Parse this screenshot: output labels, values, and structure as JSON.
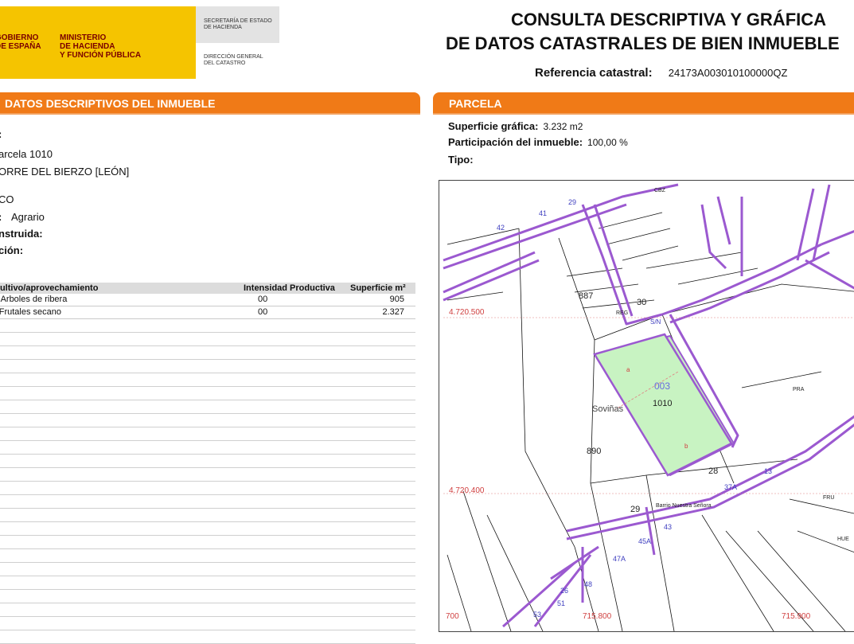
{
  "header": {
    "gov_line1": "GOBIERNO",
    "gov_line2": "DE ESPAÑA",
    "min_line1": "MINISTERIO",
    "min_line2": "DE HACIENDA",
    "min_line3": "Y FUNCIÓN PÚBLICA",
    "sec_line1": "SECRETARÍA DE ESTADO",
    "sec_line2": "DE HACIENDA",
    "dir_line1": "DIRECCIÓN GENERAL",
    "dir_line2": "DEL CATASTRO",
    "title_line1": "CONSULTA DESCRIPTIVA Y GRÁFICA",
    "title_line2": "DE DATOS CATASTRALES DE BIEN INMUEBLE",
    "ref_label": "Referencia catastral:",
    "ref_value": "24173A003010100000QZ"
  },
  "left": {
    "section_title": "DATOS DESCRIPTIVOS DEL INMUEBLE",
    "fields": {
      "f1": ":",
      "f2": "arcela 1010",
      "f3": "ORRE DEL BIERZO [LEÓN]",
      "f4": "CO",
      "f5_label": ":",
      "f5_value": "Agrario",
      "f6": "nstruida:",
      "f7": "ción:"
    },
    "table": {
      "headers": [
        "Cultivo/aprovechamiento",
        "Intensidad Productiva",
        "Superficie m²"
      ],
      "rows": [
        [
          "d Arboles de ribera",
          "00",
          "905"
        ],
        [
          "- Frutales secano",
          "00",
          "2.327"
        ]
      ]
    }
  },
  "right": {
    "section_title": "PARCELA",
    "sup_label": "Superficie gráfica:",
    "sup_value": "3.232 m2",
    "part_label": "Participación del inmueble:",
    "part_value": "100,00 %",
    "tipo_label": "Tipo:"
  },
  "map": {
    "coord_y1": "4.720.500",
    "coord_y2": "4.720.400",
    "coord_x1": "700",
    "coord_x2": "715.800",
    "coord_x3": "715.900",
    "polygon": "003",
    "parcel": "1010",
    "place": "Soviñas",
    "neighbourhood": "Barrio Nuestra Señora",
    "p887": "887",
    "p890": "890",
    "p30": "30",
    "p28": "28",
    "p29": "29",
    "sub_a": "a",
    "sub_b": "b",
    "reg": "REG",
    "pra": "PRA",
    "fru": "FRU",
    "cbz": "CBZ",
    "hue": "HUE",
    "sn": "S/N",
    "n41": "41",
    "n42": "42",
    "n29": "29",
    "n13": "13",
    "n43": "43",
    "n45": "45A",
    "n47": "47A",
    "n48": "48",
    "n53": "53",
    "n51": "51",
    "n37": "37A",
    "n26": "26"
  }
}
